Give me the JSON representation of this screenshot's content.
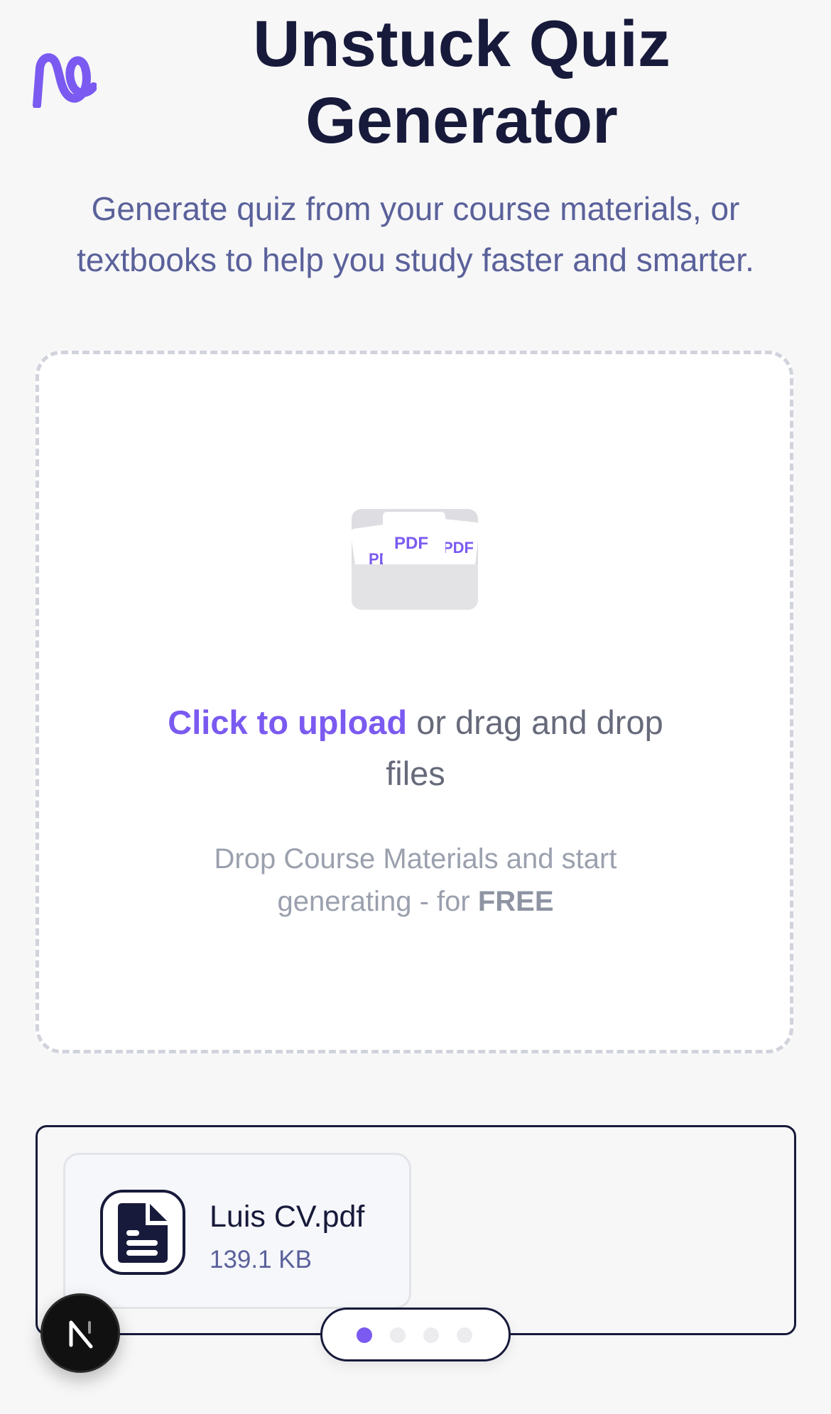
{
  "header": {
    "logo_icon": "unstuck-logo-icon",
    "title": "Unstuck Quiz Generator",
    "subtitle": "Generate quiz from your course materials, or textbooks to help you study faster and smarter."
  },
  "upload": {
    "illustration_labels": [
      "PDF",
      "PDF",
      "PDF"
    ],
    "link_text": "Click to upload",
    "rest_text": " or drag and drop files",
    "sub_text": "Drop Course Materials and start generating - for ",
    "sub_bold": "FREE"
  },
  "files": [
    {
      "name": "Luis CV.pdf",
      "size": "139.1 KB",
      "icon": "document-icon"
    }
  ],
  "pager": {
    "count": 4,
    "active": 0
  },
  "fab": {
    "icon": "nextjs-logo-icon"
  },
  "colors": {
    "accent": "#7a5af0",
    "navy": "#171a3a",
    "muted": "#5a619a"
  }
}
